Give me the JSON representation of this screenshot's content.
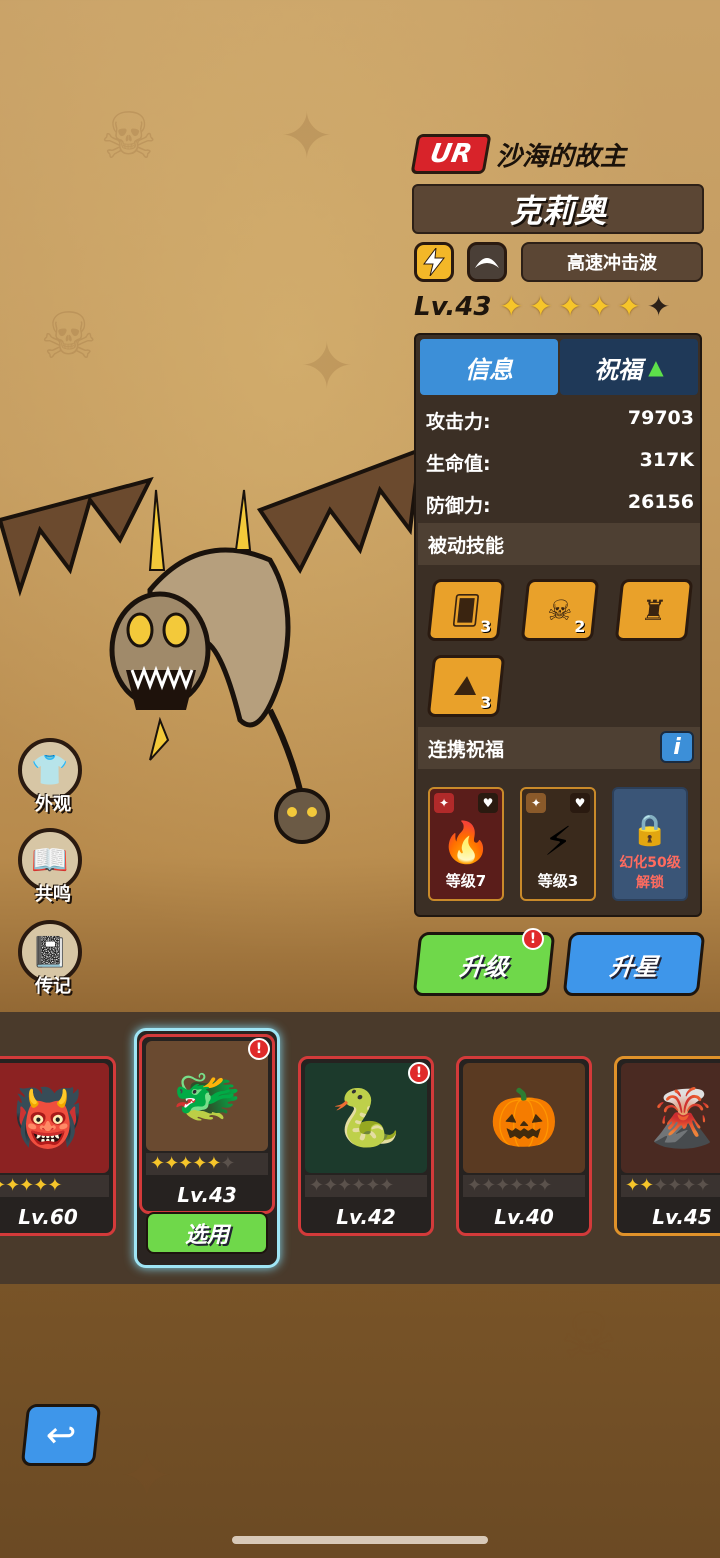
{
  "hero": {
    "rarity": "UR",
    "title": "沙海的故主",
    "name": "克莉奥",
    "skill_name": "高速冲击波",
    "level": "Lv.43",
    "stars_filled": 5,
    "stars_total": 6
  },
  "tabs": {
    "info": "信息",
    "bless": "祝福"
  },
  "stats": [
    {
      "label": "攻击力:",
      "value": "79703"
    },
    {
      "label": "生命值:",
      "value": "317K"
    },
    {
      "label": "防御力:",
      "value": "26156"
    }
  ],
  "passive": {
    "title": "被动技能",
    "skills": [
      {
        "icon": "card-lightning-icon",
        "count": "3"
      },
      {
        "icon": "skull-gear-icon",
        "count": "2"
      },
      {
        "icon": "hooded-figure-icon",
        "count": ""
      },
      {
        "icon": "rock-lightning-icon",
        "count": "3"
      }
    ]
  },
  "link_bless": {
    "title": "连携祝福",
    "info_label": "i",
    "cards": [
      {
        "label": "等级7"
      },
      {
        "label": "等级3"
      },
      {
        "label": "幻化50级 解锁",
        "line1": "幻化50级",
        "line2": "解锁"
      }
    ]
  },
  "buttons": {
    "upgrade": "升级",
    "star_up": "升星",
    "choose": "选用",
    "alert": "!"
  },
  "side": {
    "appearance": "外观",
    "resonance": "共鸣",
    "biography": "传记"
  },
  "roster": [
    {
      "level": "Lv.60",
      "stars": 5,
      "stars_total": 5
    },
    {
      "level": "Lv.43",
      "stars": 5,
      "stars_total": 6
    },
    {
      "level": "Lv.42",
      "stars": 0,
      "stars_total": 6
    },
    {
      "level": "Lv.40",
      "stars": 0,
      "stars_total": 6
    },
    {
      "level": "Lv.45",
      "stars": 2,
      "stars_total": 6
    }
  ],
  "colors": {
    "accent_blue": "#3c8fd8",
    "accent_green": "#6fd84a",
    "rarity_red": "#d8232a",
    "star_gold": "#f6c52a"
  }
}
